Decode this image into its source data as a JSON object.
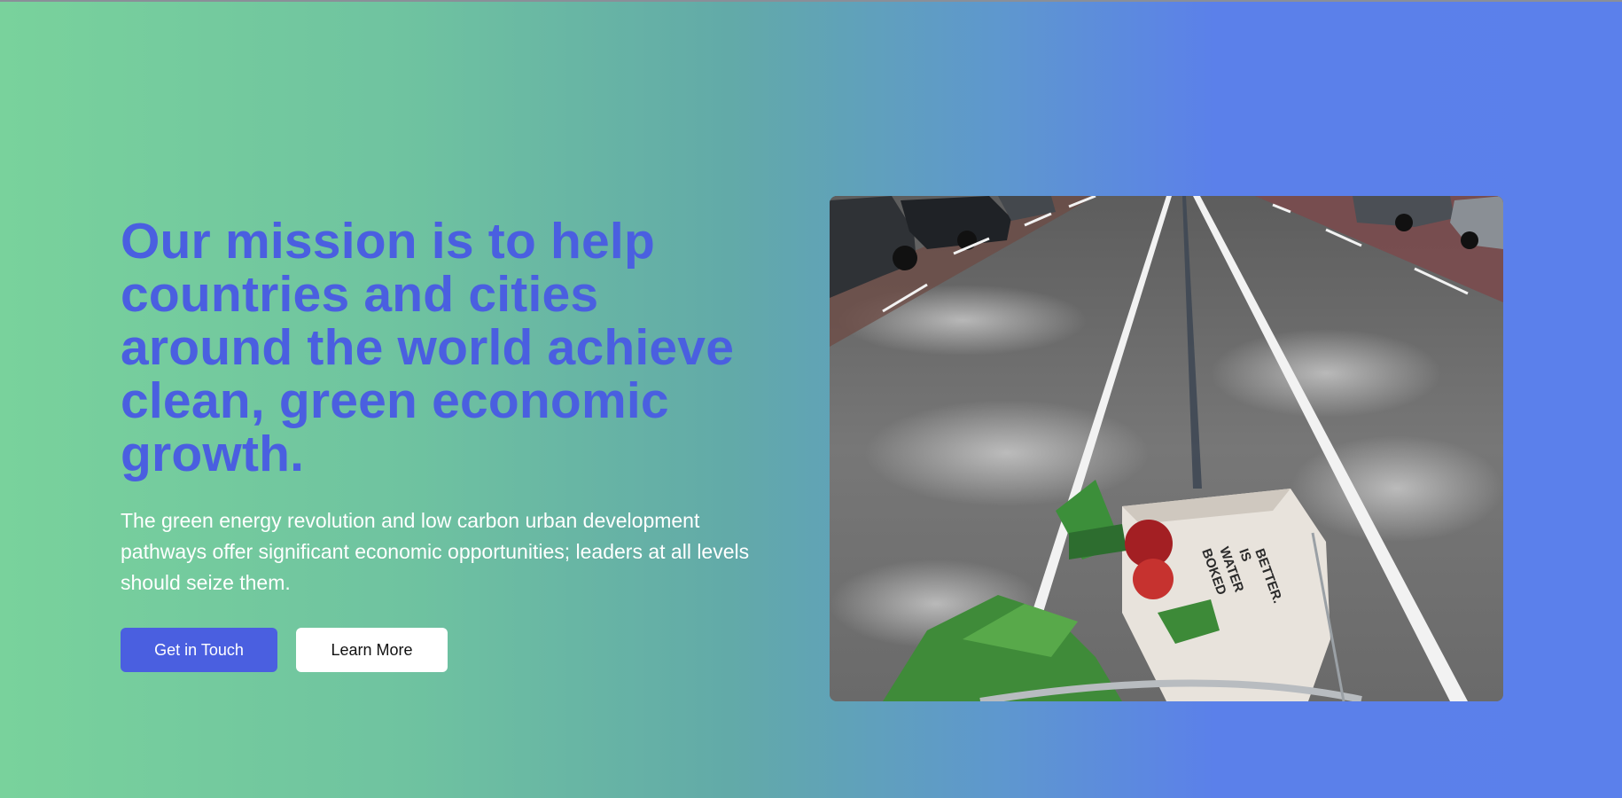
{
  "hero": {
    "headline": "Our mission is to help countries and cities around the world achieve clean, green economic growth.",
    "description": "The green energy revolution and low carbon urban development pathways offer significant economic opportunities; leaders at all levels should seize them.",
    "primary_button_label": "Get in Touch",
    "secondary_button_label": "Learn More"
  },
  "image": {
    "subject": "bike lane with groceries in a front basket",
    "bag_print": [
      "BOKED",
      "WATER",
      "IS",
      "BETTER."
    ]
  },
  "colors": {
    "gradient_start": "#79d29c",
    "gradient_end": "#5b80eb",
    "headline": "#4a5fe0",
    "primary_button": "#4a5fe0",
    "secondary_button": "#ffffff"
  }
}
